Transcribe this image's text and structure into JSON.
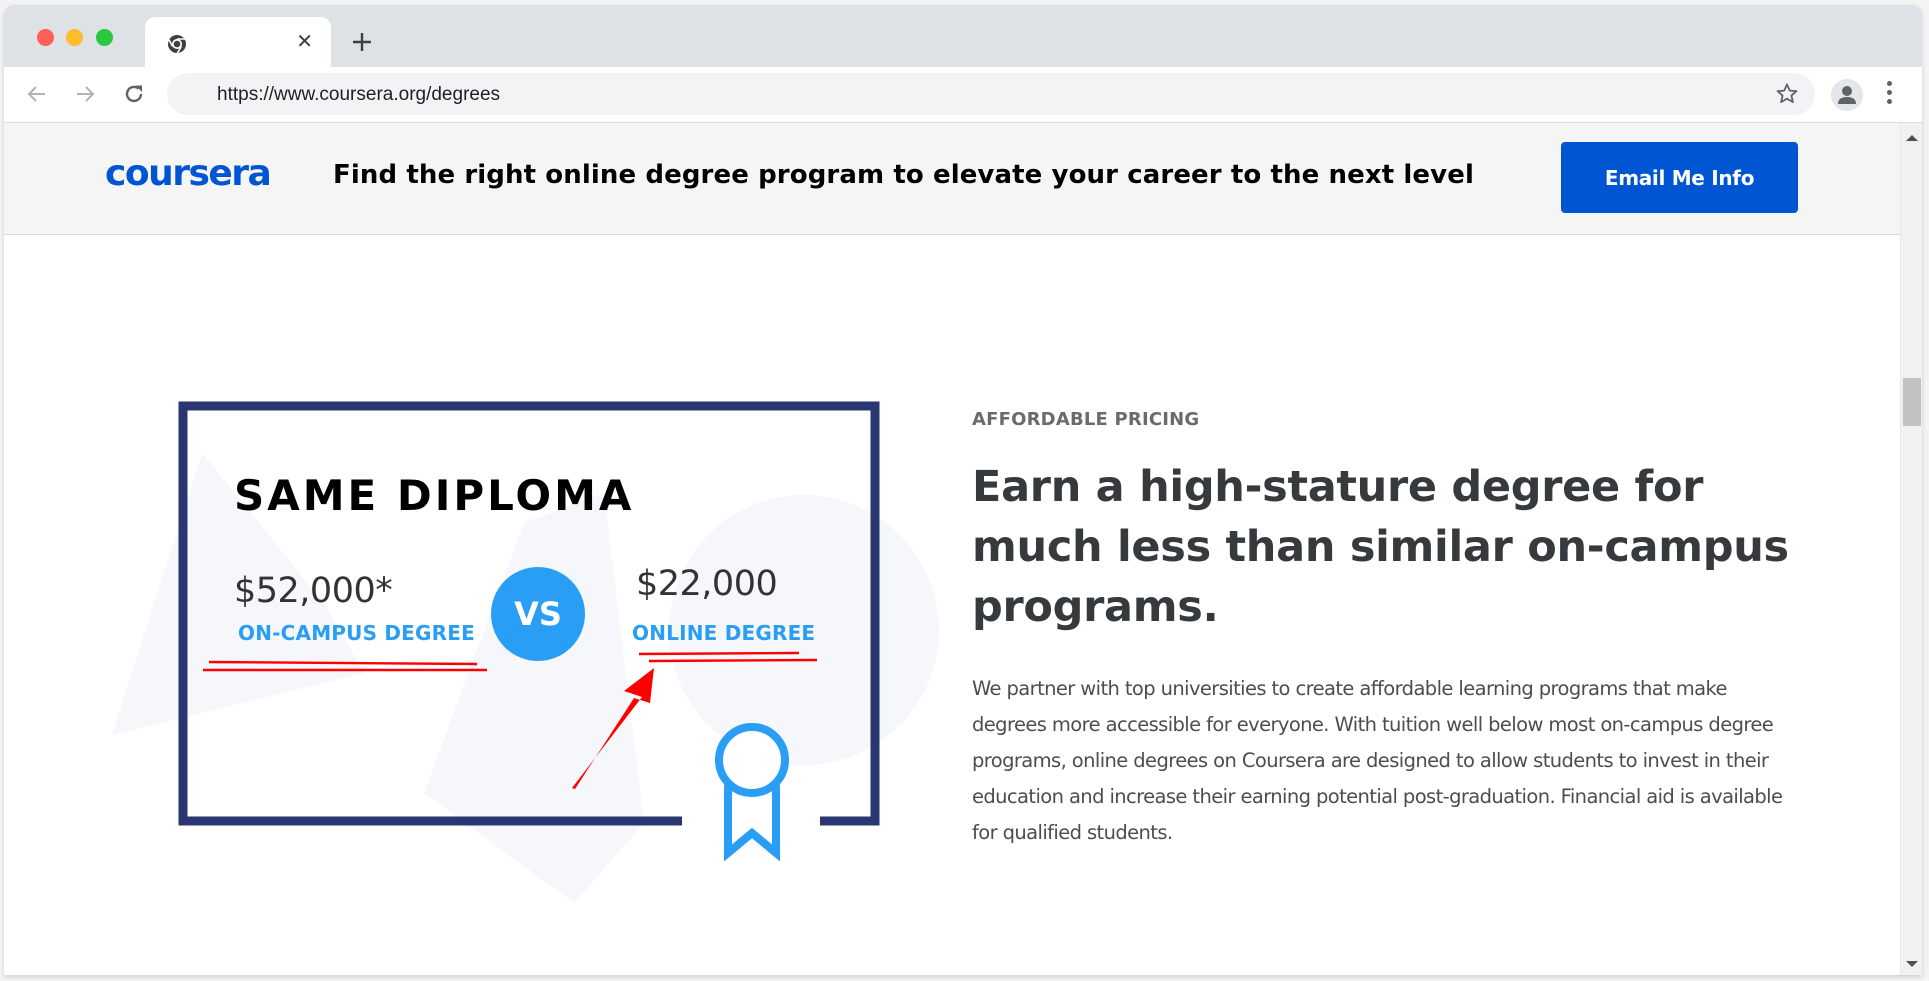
{
  "browser": {
    "tab": {
      "title": "",
      "favicon": "chrome-icon",
      "close_icon": "close-icon"
    },
    "new_tab_icon": "plus-icon",
    "toolbar": {
      "back_icon": "arrow-left-icon",
      "forward_icon": "arrow-right-icon",
      "reload_icon": "reload-icon",
      "url": "https://www.coursera.org/degrees",
      "bookmark_icon": "star-icon",
      "profile_icon": "person-icon",
      "menu_icon": "kebab-menu-icon"
    }
  },
  "header": {
    "logo": "coursera",
    "title": "Find the right online degree program to elevate your career to the next level",
    "cta_label": "Email Me Info"
  },
  "illustration": {
    "title": "SAME DIPLOMA",
    "campus": {
      "price": "$52,000*",
      "label": "ON-CAMPUS DEGREE"
    },
    "vs_label": "VS",
    "online": {
      "price": "$22,000",
      "label": "ONLINE DEGREE"
    },
    "annotation": {
      "type": "red underline + arrow",
      "target": "ONLINE DEGREE"
    }
  },
  "content": {
    "eyebrow": "AFFORDABLE PRICING",
    "headline": "Earn a high-stature degree for much less than similar on-campus programs.",
    "body": "We partner with top universities to create affordable learning programs that make degrees more accessible for everyone. With tuition well below most on-campus degree programs, online degrees on Coursera are designed to allow students to invest in their education and increase their earning potential post-graduation. Financial aid is available for qualified students."
  },
  "colors": {
    "brand": "#0056d2",
    "accent": "#2a9df4",
    "frame": "#2a3672",
    "annotation": "#ff0000"
  }
}
